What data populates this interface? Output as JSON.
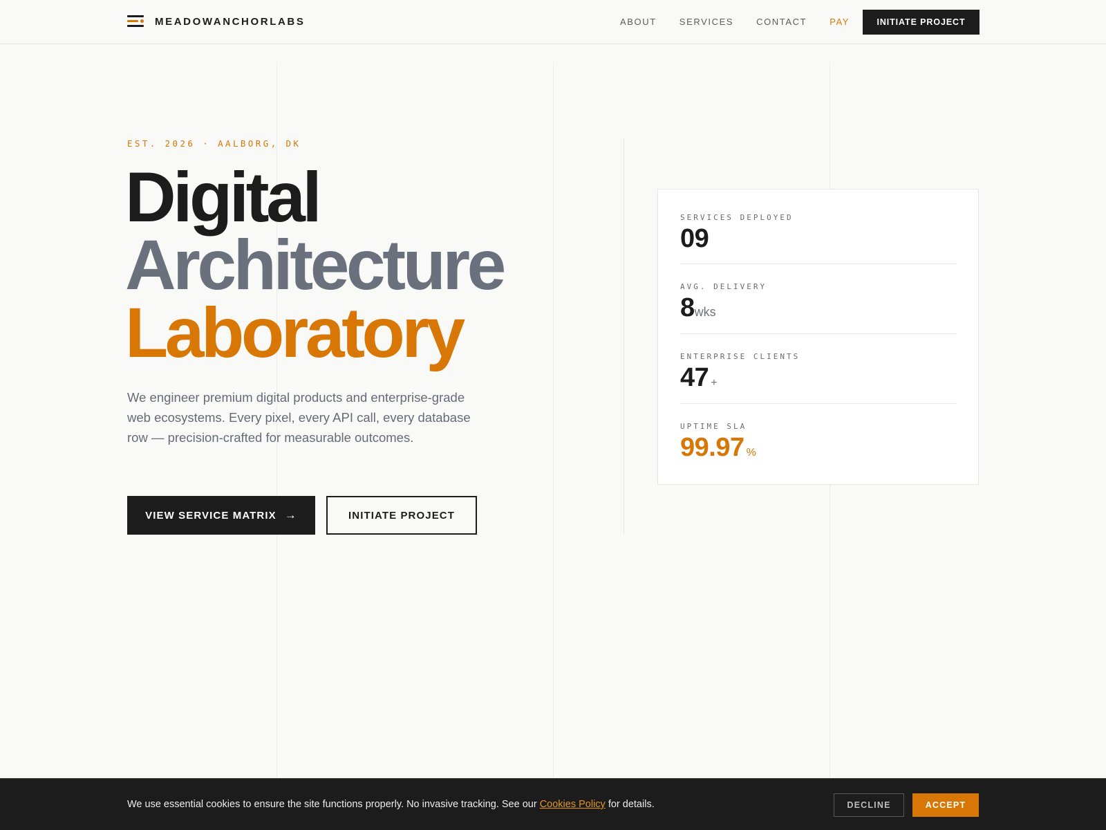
{
  "brand": {
    "name": "MEADOWANCHORLABS"
  },
  "nav": {
    "items": [
      {
        "label": "ABOUT"
      },
      {
        "label": "SERVICES"
      },
      {
        "label": "CONTACT"
      },
      {
        "label": "PAY"
      }
    ],
    "cta_label": "INITIATE PROJECT"
  },
  "hero": {
    "eyebrow": "EST. 2026 · AALBORG, DK",
    "headline": {
      "line1": "Digital",
      "line2": "Architecture",
      "line3": "Laboratory"
    },
    "lead": "We engineer premium digital products and enterprise-grade web ecosystems. Every pixel, every API call, every database row — precision-crafted for measurable outcomes.",
    "primary_button": "VIEW SERVICE MATRIX",
    "primary_arrow": "→",
    "secondary_button": "INITIATE PROJECT"
  },
  "stats": [
    {
      "label": "SERVICES DEPLOYED",
      "value": "09",
      "unit": ""
    },
    {
      "label": "AVG. DELIVERY",
      "value": "8",
      "unit": "wks"
    },
    {
      "label": "ENTERPRISE CLIENTS",
      "value": "47",
      "unit": "+"
    },
    {
      "label": "UPTIME SLA",
      "value": "99.97",
      "unit": "%"
    }
  ],
  "cookie": {
    "text_before": "We use essential cookies to ensure the site functions properly. No invasive tracking. See our ",
    "link": "Cookies Policy",
    "text_after": " for details.",
    "decline": "DECLINE",
    "accept": "ACCEPT"
  },
  "colors": {
    "accent": "#d97706",
    "ink": "#1c1c1c",
    "muted": "#6b717c",
    "background": "#f9f9f7"
  }
}
